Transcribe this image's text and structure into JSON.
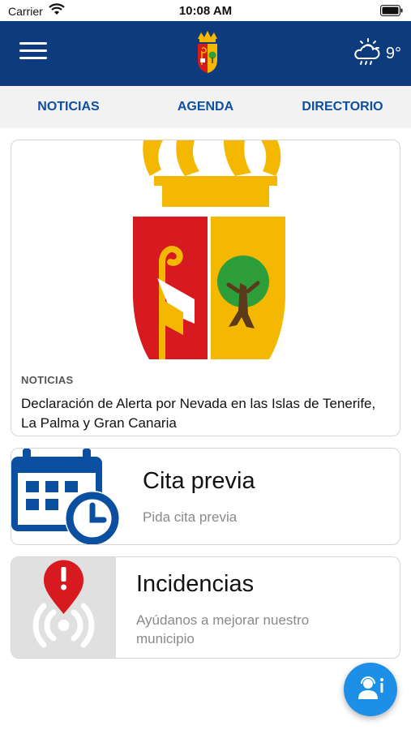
{
  "status_bar": {
    "carrier": "Carrier",
    "time": "10:08 AM"
  },
  "header": {
    "weather_icon": "cloud-rain-sun-icon",
    "temperature": "9°",
    "colors": {
      "background": "#0d3b7d",
      "text": "#ffffff"
    }
  },
  "tabs": [
    {
      "label": "NOTICIAS"
    },
    {
      "label": "AGENDA"
    },
    {
      "label": "DIRECTORIO"
    }
  ],
  "news": {
    "category": "NOTICIAS",
    "title": "Declaración de Alerta por Nevada en las Islas de Tenerife, La Palma y Gran Canaria"
  },
  "cita": {
    "title": "Cita previa",
    "subtitle": "Pida cita previa",
    "icon": "calendar-clock-icon"
  },
  "incidencias": {
    "title": "Incidencias",
    "subtitle": "Ayúdanos a mejorar nuestro municipio",
    "icon": "location-alert-icon"
  },
  "fab": {
    "icon": "support-agent-icon"
  },
  "colors": {
    "primary": "#0d3b7d",
    "tab_text": "#0d4fa3",
    "calendar_blue": "#0a4fa0",
    "alert_red": "#d71920",
    "fab": "#1e8fe6",
    "crest_red": "#d71920",
    "crest_yellow": "#f5b800",
    "crest_green": "#2e9e3a"
  }
}
